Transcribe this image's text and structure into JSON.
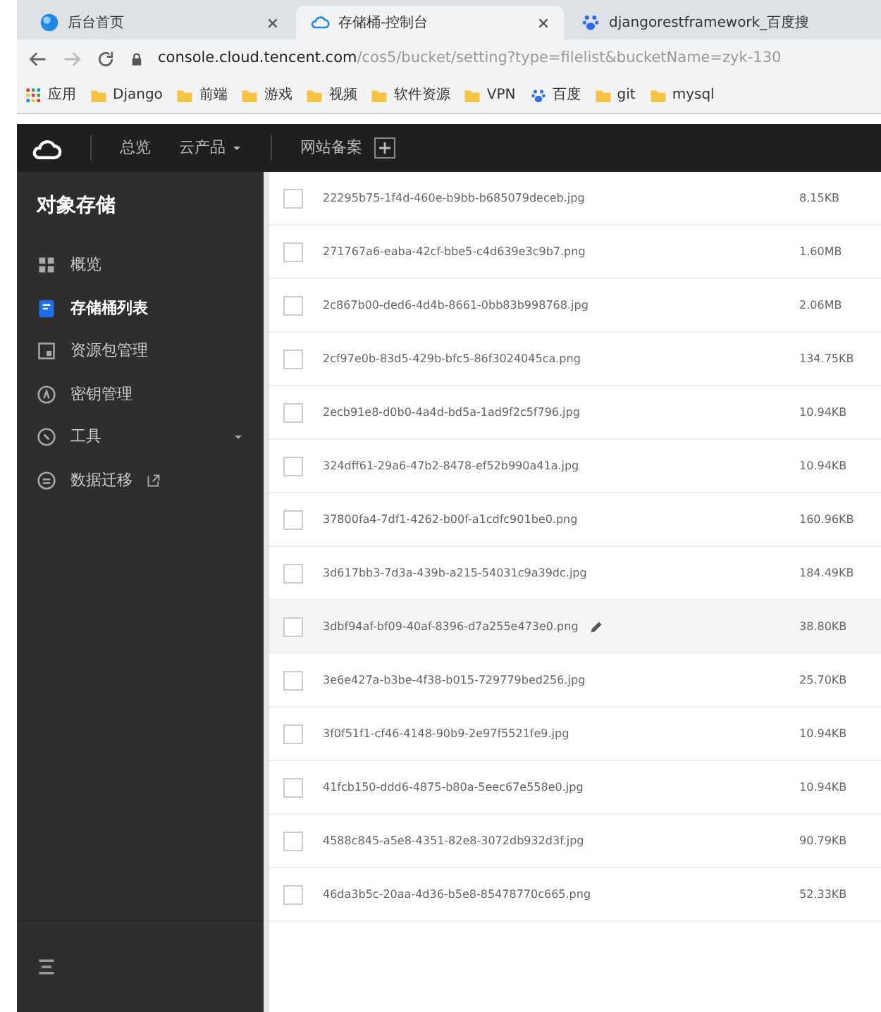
{
  "browser": {
    "tabs": [
      {
        "title": "后台首页",
        "selected": false
      },
      {
        "title": "存储桶-控制台",
        "selected": true
      },
      {
        "title": "djangorestframework_百度搜",
        "selected": false
      }
    ],
    "url_host": "console.cloud.tencent.com",
    "url_path": "/cos5/bucket/setting?type=filelist&bucketName=zyk-130",
    "bookmarks": [
      {
        "label": "应用",
        "kind": "apps"
      },
      {
        "label": "Django",
        "kind": "folder"
      },
      {
        "label": "前端",
        "kind": "folder"
      },
      {
        "label": "游戏",
        "kind": "folder"
      },
      {
        "label": "视频",
        "kind": "folder"
      },
      {
        "label": "软件资源",
        "kind": "folder"
      },
      {
        "label": "VPN",
        "kind": "folder"
      },
      {
        "label": "百度",
        "kind": "paw"
      },
      {
        "label": "git",
        "kind": "folder"
      },
      {
        "label": "mysql",
        "kind": "folder"
      }
    ]
  },
  "topbar": {
    "items": [
      {
        "label": "总览",
        "dropdown": false
      },
      {
        "label": "云产品",
        "dropdown": true
      }
    ],
    "extra": "网站备案"
  },
  "sidebar": {
    "title": "对象存储",
    "items": [
      {
        "label": "概览",
        "selected": false
      },
      {
        "label": "存储桶列表",
        "selected": true
      },
      {
        "label": "资源包管理",
        "selected": false
      },
      {
        "label": "密钥管理",
        "selected": false
      },
      {
        "label": "工具",
        "selected": false,
        "expandable": true
      },
      {
        "label": "数据迁移",
        "selected": false,
        "external": true
      }
    ]
  },
  "files": [
    {
      "name": "22295b75-1f4d-460e-b9bb-b685079deceb.jpg",
      "size": "8.15KB",
      "hovered": false,
      "checked": false
    },
    {
      "name": "271767a6-eaba-42cf-bbe5-c4d639e3c9b7.png",
      "size": "1.60MB",
      "hovered": false,
      "checked": false
    },
    {
      "name": "2c867b00-ded6-4d4b-8661-0bb83b998768.jpg",
      "size": "2.06MB",
      "hovered": false,
      "checked": false
    },
    {
      "name": "2cf97e0b-83d5-429b-bfc5-86f3024045ca.png",
      "size": "134.75KB",
      "hovered": false,
      "checked": false
    },
    {
      "name": "2ecb91e8-d0b0-4a4d-bd5a-1ad9f2c5f796.jpg",
      "size": "10.94KB",
      "hovered": false,
      "checked": false
    },
    {
      "name": "324dff61-29a6-47b2-8478-ef52b990a41a.jpg",
      "size": "10.94KB",
      "hovered": false,
      "checked": false
    },
    {
      "name": "37800fa4-7df1-4262-b00f-a1cdfc901be0.png",
      "size": "160.96KB",
      "hovered": false,
      "checked": false
    },
    {
      "name": "3d617bb3-7d3a-439b-a215-54031c9a39dc.jpg",
      "size": "184.49KB",
      "hovered": false,
      "checked": false
    },
    {
      "name": "3dbf94af-bf09-40af-8396-d7a255e473e0.png",
      "size": "38.80KB",
      "hovered": true,
      "checked": false
    },
    {
      "name": "3e6e427a-b3be-4f38-b015-729779bed256.jpg",
      "size": "25.70KB",
      "hovered": false,
      "checked": false
    },
    {
      "name": "3f0f51f1-cf46-4148-90b9-2e97f5521fe9.jpg",
      "size": "10.94KB",
      "hovered": false,
      "checked": false
    },
    {
      "name": "41fcb150-ddd6-4875-b80a-5eec67e558e0.jpg",
      "size": "10.94KB",
      "hovered": false,
      "checked": false
    },
    {
      "name": "4588c845-a5e8-4351-82e8-3072db932d3f.jpg",
      "size": "90.79KB",
      "hovered": false,
      "checked": false
    },
    {
      "name": "46da3b5c-20aa-4d36-b5e8-85478770c665.png",
      "size": "52.33KB",
      "hovered": false,
      "checked": false
    }
  ]
}
